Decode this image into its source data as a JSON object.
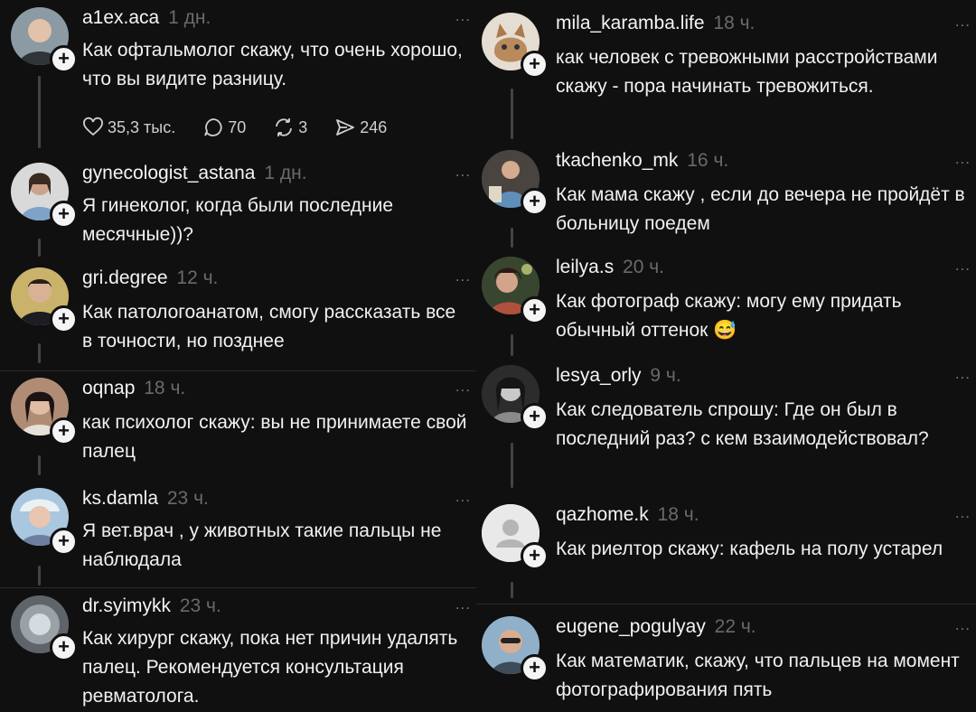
{
  "left": [
    {
      "username": "a1ex.aca",
      "time": "1 дн.",
      "text": "Как офтальмолог скажу, что очень хорошо, что вы видите разницу.",
      "stats": {
        "likes": "35,3 тыс.",
        "replies": "70",
        "reposts": "3",
        "shares": "246"
      }
    },
    {
      "username": "gynecologist_astana",
      "time": "1 дн.",
      "text": "Я гинеколог, когда были последние месячные))?"
    },
    {
      "username": "gri.degree",
      "time": "12 ч.",
      "text": "Как патологоанатом, смогу рассказать все в точности, но позднее"
    },
    {
      "username": "oqnap",
      "time": "18 ч.",
      "text": "как психолог скажу: вы не принимаете свой палец"
    },
    {
      "username": "ks.damla",
      "time": "23 ч.",
      "text": "Я вет.врач , у животных такие пальцы не наблюдала"
    },
    {
      "username": "dr.syimykk",
      "time": "23 ч.",
      "text": "Как хирург скажу, пока нет причин удалять палец. Рекомендуется консультация ревматолога."
    }
  ],
  "right": [
    {
      "username": "mila_karamba.life",
      "time": "18 ч.",
      "text": "как человек с тревожными расстройствами скажу - пора начинать тревожиться."
    },
    {
      "username": "tkachenko_mk",
      "time": "16 ч.",
      "text": "Как мама скажу , если до вечера не пройдёт в больницу поедем"
    },
    {
      "username": "leilya.s",
      "time": "20 ч.",
      "text": "Как фотограф скажу: могу ему придать обычный оттенок 😅"
    },
    {
      "username": "lesya_orly",
      "time": "9 ч.",
      "text": "Как следователь спрошу: Где он был в последний раз? с кем взаимодействовал?"
    },
    {
      "username": "qazhome.k",
      "time": "18 ч.",
      "text": "Как риелтор скажу: кафель на полу устарел"
    },
    {
      "username": "eugene_pogulyay",
      "time": "22 ч.",
      "text": "Как математик, скажу, что пальцев на момент фотографирования пять"
    }
  ],
  "more_label": "...",
  "plus_label": "+",
  "icons": [
    "heart-icon",
    "reply-icon",
    "repost-icon",
    "share-icon",
    "more-icon",
    "plus-icon"
  ],
  "colors": {
    "background": "#101010",
    "text": "#f3f3f3",
    "muted": "#6a6a6a"
  }
}
